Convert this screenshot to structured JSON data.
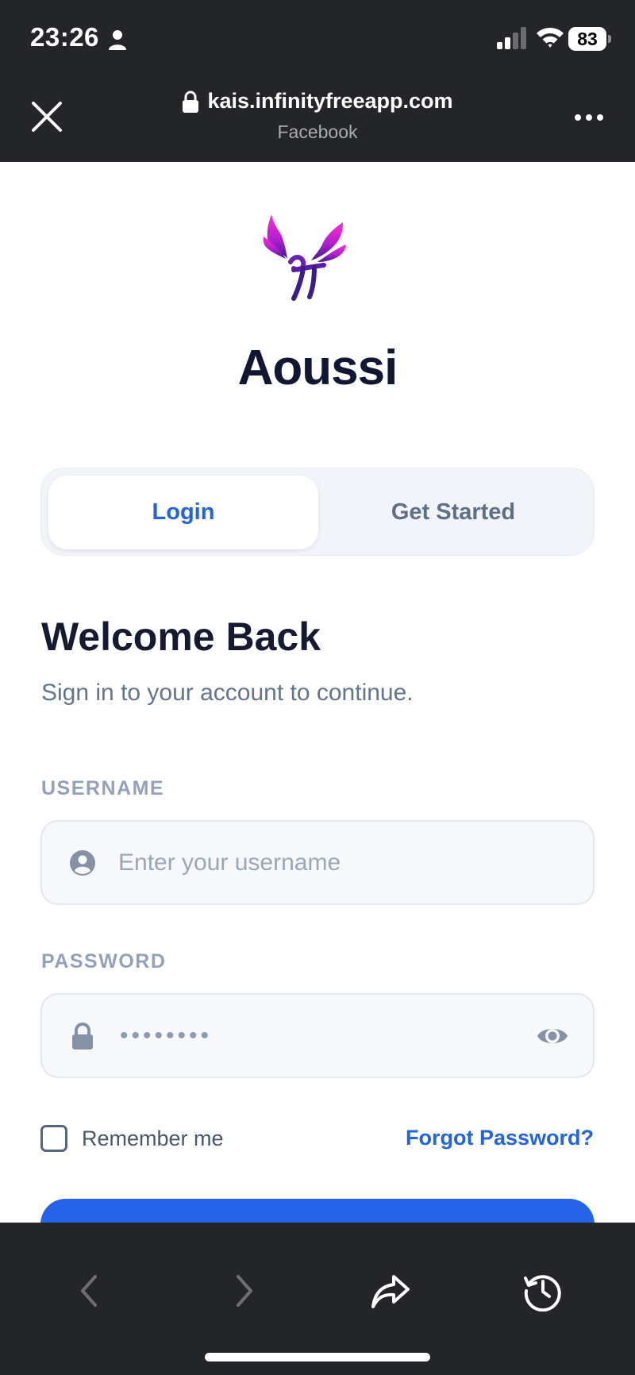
{
  "status_bar": {
    "time": "23:26",
    "battery": "83"
  },
  "browser": {
    "url": "kais.infinityfreeapp.com",
    "site_name": "Facebook"
  },
  "brand": {
    "name": "Aoussi",
    "logo_colors": [
      "#e81fc3",
      "#7b2fd6",
      "#3b1c8c"
    ]
  },
  "tabs": [
    {
      "label": "Login",
      "active": true
    },
    {
      "label": "Get Started",
      "active": false
    }
  ],
  "login": {
    "heading": "Welcome Back",
    "subtitle": "Sign in to your account to continue.",
    "username_label": "USERNAME",
    "username_placeholder": "Enter your username",
    "password_label": "PASSWORD",
    "password_masked": "••••••••",
    "remember_label": "Remember me",
    "remember_checked": false,
    "forgot_label": "Forgot Password?"
  },
  "colors": {
    "accent": "#2563eb",
    "heading": "#151a30",
    "chrome": "#242528"
  },
  "icons": [
    "person-icon",
    "signal-icon",
    "wifi-icon",
    "close-icon",
    "lock-icon",
    "more-icon",
    "user-circle-icon",
    "padlock-icon",
    "eye-icon",
    "back-arrow-icon",
    "forward-arrow-icon",
    "share-icon",
    "history-icon"
  ]
}
